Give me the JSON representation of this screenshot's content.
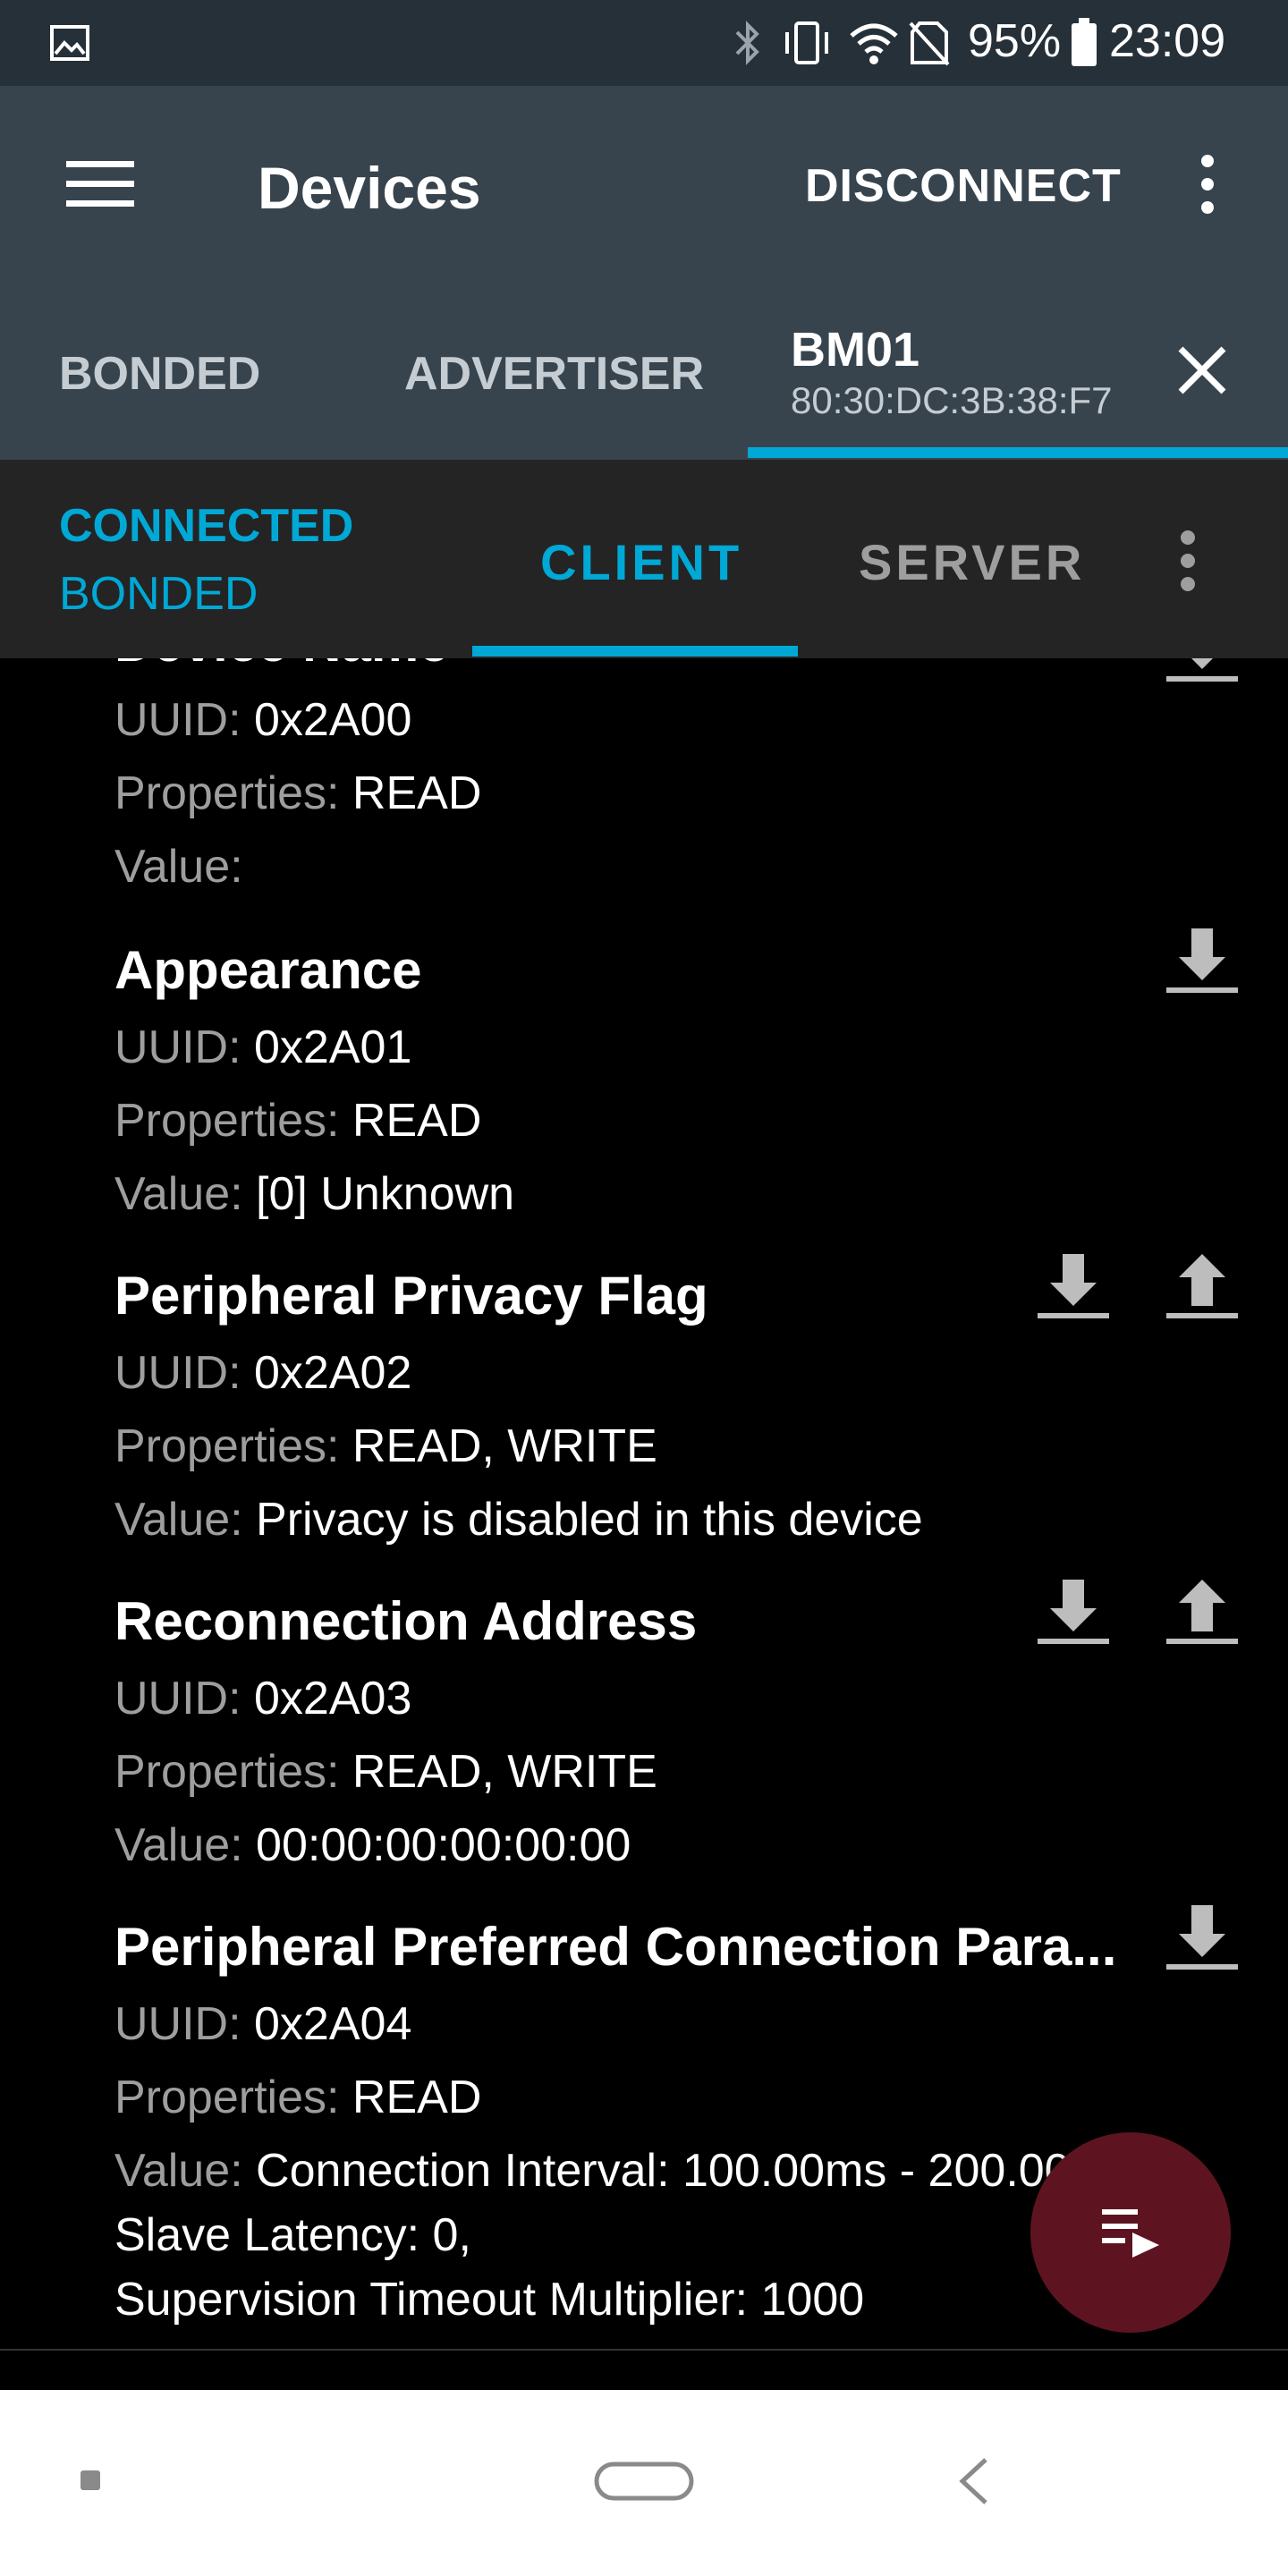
{
  "status_bar": {
    "battery": "95%",
    "time": "23:09",
    "icons": [
      "gallery-icon",
      "bluetooth-icon",
      "vibrate-icon",
      "wifi-icon",
      "no-sim-icon",
      "battery-icon"
    ]
  },
  "app_bar": {
    "title": "Devices",
    "disconnect_label": "DISCONNECT"
  },
  "device_tabs": {
    "bonded": "BONDED",
    "advertiser": "ADVERTISER",
    "device_name": "BM01",
    "device_address": "80:30:DC:3B:38:F7"
  },
  "connection": {
    "state": "CONNECTED",
    "bond": "BONDED",
    "tab_client": "CLIENT",
    "tab_server": "SERVER"
  },
  "labels": {
    "uuid": "UUID:",
    "properties": "Properties:",
    "value": "Value:"
  },
  "characteristics": [
    {
      "name": "Device Name",
      "uuid": "0x2A00",
      "properties": "READ",
      "value": ""
    },
    {
      "name": "Appearance",
      "uuid": "0x2A01",
      "properties": "READ",
      "value": "[0] Unknown"
    },
    {
      "name": "Peripheral Privacy Flag",
      "uuid": "0x2A02",
      "properties": "READ, WRITE",
      "value": "Privacy is disabled in this device"
    },
    {
      "name": "Reconnection Address",
      "uuid": "0x2A03",
      "properties": "READ, WRITE",
      "value": "00:00:00:00:00:00"
    },
    {
      "name": "Peripheral Preferred Connection Para...",
      "uuid": "0x2A04",
      "properties": "READ",
      "value": "Connection Interval: 100.00ms - 200.00ms,",
      "value_line2": "Slave Latency: 0,",
      "value_line3": "Supervision Timeout Multiplier: 1000"
    }
  ],
  "colors": {
    "accent": "#00a8d6",
    "app_bar": "#37444e",
    "status_bar": "#263038",
    "fab": "#5e1420"
  }
}
